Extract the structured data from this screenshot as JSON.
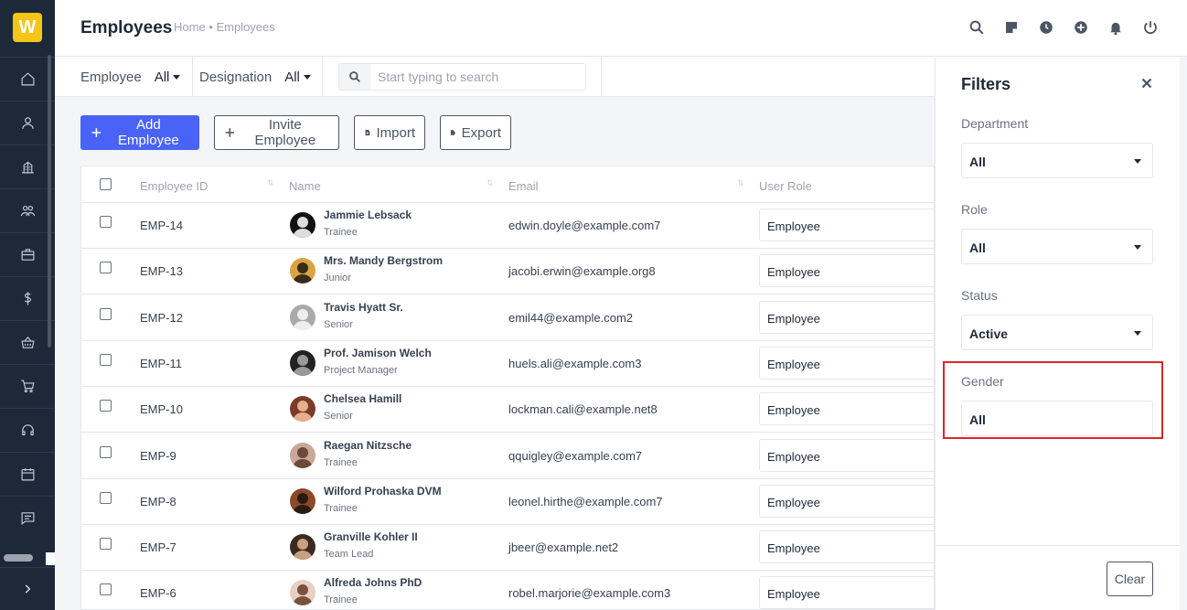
{
  "app": {
    "logo_letter": "W",
    "accent": "#4a63f7",
    "sidebar_bg": "#1d2939"
  },
  "sidebar": {
    "icons": [
      "home-icon",
      "user-icon",
      "building-icon",
      "users-icon",
      "briefcase-icon",
      "dollar-icon",
      "basket-icon",
      "cart-icon",
      "headset-icon",
      "calendar-icon",
      "message-icon"
    ]
  },
  "header": {
    "title": "Employees",
    "breadcrumb": "Home • Employees",
    "icons": [
      "search-icon",
      "sticky-note-icon",
      "clock-icon",
      "plus-circle-icon",
      "bell-icon",
      "power-icon"
    ]
  },
  "filterbar": {
    "employee_label": "Employee",
    "employee_value": "All",
    "designation_label": "Designation",
    "designation_value": "All",
    "search_placeholder": "Start typing to search"
  },
  "actions": {
    "add": "Add Employee",
    "invite": "Invite Employee",
    "import": "Import",
    "export": "Export"
  },
  "table": {
    "columns": [
      "Employee ID",
      "Name",
      "Email",
      "User Role"
    ],
    "rows": [
      {
        "id": "EMP-14",
        "name": "Jammie Lebsack",
        "role": "Trainee",
        "email": "edwin.doyle@example.com7",
        "user_role": "Employee"
      },
      {
        "id": "EMP-13",
        "name": "Mrs. Mandy Bergstrom",
        "role": "Junior",
        "email": "jacobi.erwin@example.org8",
        "user_role": "Employee"
      },
      {
        "id": "EMP-12",
        "name": "Travis Hyatt Sr.",
        "role": "Senior",
        "email": "emil44@example.com2",
        "user_role": "Employee"
      },
      {
        "id": "EMP-11",
        "name": "Prof. Jamison Welch",
        "role": "Project Manager",
        "email": "huels.ali@example.com3",
        "user_role": "Employee"
      },
      {
        "id": "EMP-10",
        "name": "Chelsea Hamill",
        "role": "Senior",
        "email": "lockman.cali@example.net8",
        "user_role": "Employee"
      },
      {
        "id": "EMP-9",
        "name": "Raegan Nitzsche",
        "role": "Trainee",
        "email": "qquigley@example.com7",
        "user_role": "Employee"
      },
      {
        "id": "EMP-8",
        "name": "Wilford Prohaska DVM",
        "role": "Trainee",
        "email": "leonel.hirthe@example.com7",
        "user_role": "Employee"
      },
      {
        "id": "EMP-7",
        "name": "Granville Kohler II",
        "role": "Team Lead",
        "email": "jbeer@example.net2",
        "user_role": "Employee"
      },
      {
        "id": "EMP-6",
        "name": "Alfreda Johns PhD",
        "role": "Trainee",
        "email": "robel.marjorie@example.com3",
        "user_role": "Employee"
      }
    ]
  },
  "filters": {
    "title": "Filters",
    "department_label": "Department",
    "department_value": "All",
    "role_label": "Role",
    "role_value": "All",
    "status_label": "Status",
    "status_value": "Active",
    "gender_label": "Gender",
    "gender_value": "All",
    "clear": "Clear",
    "highlight_color": "#dc2626"
  }
}
